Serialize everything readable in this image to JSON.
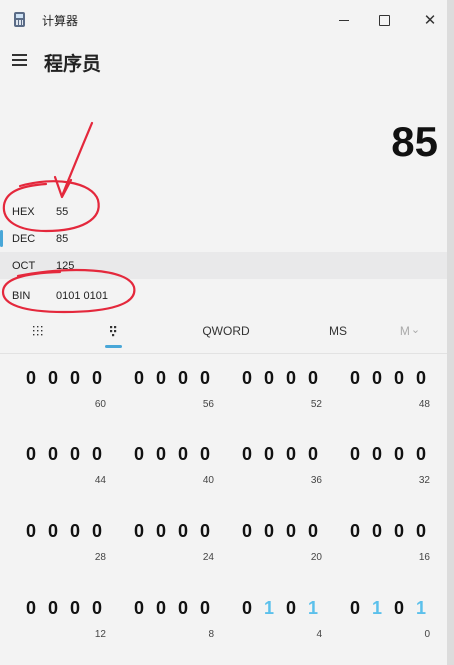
{
  "window": {
    "title": "计算器",
    "min_icon": "minimize-icon",
    "max_icon": "maximize-icon",
    "close_glyph": "✕"
  },
  "header": {
    "menu_icon": "hamburger-menu-icon",
    "mode": "程序员"
  },
  "display": {
    "value": "85"
  },
  "radix": [
    {
      "label": "HEX",
      "value": "55"
    },
    {
      "label": "DEC",
      "value": "85"
    },
    {
      "label": "OCT",
      "value": "125"
    },
    {
      "label": "BIN",
      "value": "0101 0101"
    }
  ],
  "toolbar": {
    "keypad_icon": "full-keypad-icon",
    "bit_toggle_icon": "bit-toggle-keypad-icon",
    "word_size": "QWORD",
    "ms_label": "MS",
    "m_dropdown_label": "M",
    "m_dropdown_glyph": "⌄"
  },
  "bits": {
    "rows": [
      [
        {
          "bits": [
            "0",
            "0",
            "0",
            "0"
          ],
          "pos": "60"
        },
        {
          "bits": [
            "0",
            "0",
            "0",
            "0"
          ],
          "pos": "56"
        },
        {
          "bits": [
            "0",
            "0",
            "0",
            "0"
          ],
          "pos": "52"
        },
        {
          "bits": [
            "0",
            "0",
            "0",
            "0"
          ],
          "pos": "48"
        }
      ],
      [
        {
          "bits": [
            "0",
            "0",
            "0",
            "0"
          ],
          "pos": "44"
        },
        {
          "bits": [
            "0",
            "0",
            "0",
            "0"
          ],
          "pos": "40"
        },
        {
          "bits": [
            "0",
            "0",
            "0",
            "0"
          ],
          "pos": "36"
        },
        {
          "bits": [
            "0",
            "0",
            "0",
            "0"
          ],
          "pos": "32"
        }
      ],
      [
        {
          "bits": [
            "0",
            "0",
            "0",
            "0"
          ],
          "pos": "28"
        },
        {
          "bits": [
            "0",
            "0",
            "0",
            "0"
          ],
          "pos": "24"
        },
        {
          "bits": [
            "0",
            "0",
            "0",
            "0"
          ],
          "pos": "20"
        },
        {
          "bits": [
            "0",
            "0",
            "0",
            "0"
          ],
          "pos": "16"
        }
      ],
      [
        {
          "bits": [
            "0",
            "0",
            "0",
            "0"
          ],
          "pos": "12"
        },
        {
          "bits": [
            "0",
            "0",
            "0",
            "0"
          ],
          "pos": "8"
        },
        {
          "bits": [
            "0",
            "1",
            "0",
            "1"
          ],
          "pos": "4"
        },
        {
          "bits": [
            "0",
            "1",
            "0",
            "1"
          ],
          "pos": "0"
        }
      ]
    ],
    "on_color": "#5bc0eb"
  },
  "colors": {
    "accent": "#49a7d8",
    "annotation": "#e4283c"
  }
}
